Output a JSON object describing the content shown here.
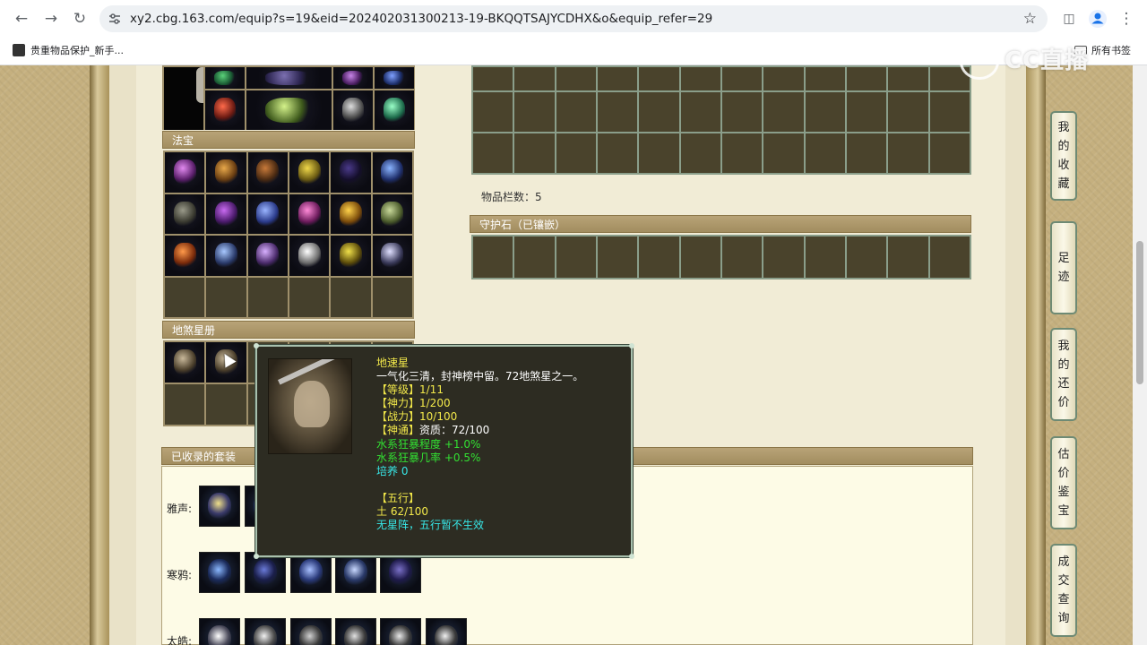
{
  "browser": {
    "url": "xy2.cbg.163.com/equip?s=19&eid=202402031300213-19-BKQQTSAJYCDHX&o&equip_refer=29",
    "bookmark_left": "贵重物品保护_新手...",
    "bookmark_right": "所有书签"
  },
  "sections": {
    "fabao": "法宝",
    "disha": "地煞星册",
    "guardian": "守护石（已镶嵌）",
    "suits": "已收录的套装"
  },
  "storage": {
    "count_label": "物品栏数：5"
  },
  "suits": [
    {
      "label": "雅声:"
    },
    {
      "label": "寒鸦:"
    },
    {
      "label": "太皓:"
    }
  ],
  "side_nav": [
    {
      "label": "我的收藏"
    },
    {
      "label": "足迹"
    },
    {
      "label": "我的还价"
    },
    {
      "label": "估价鉴宝"
    },
    {
      "label": "成交查询"
    }
  ],
  "watermark": "CC直播",
  "tooltip": {
    "name": "地速星",
    "desc": "一气化三清，封神榜中留。72地煞星之一。",
    "level": "【等级】1/11",
    "shenli": "【神力】1/200",
    "zhanli": "【战力】10/100",
    "shentong_label": "【神通】",
    "shentong_value": "资质：72/100",
    "stat1": "水系狂暴程度 +1.0%",
    "stat2": "水系狂暴几率 +0.5%",
    "peiyang": "培养 0",
    "wuxing_title": "【五行】",
    "wuxing_value": "土 62/100",
    "wuxing_note": "无星阵，五行暂不生效"
  },
  "colors": {
    "accent_panel": "#a28d5f",
    "tooltip_bg": "#2d2c22",
    "tooltip_border": "#a8c0ad"
  }
}
